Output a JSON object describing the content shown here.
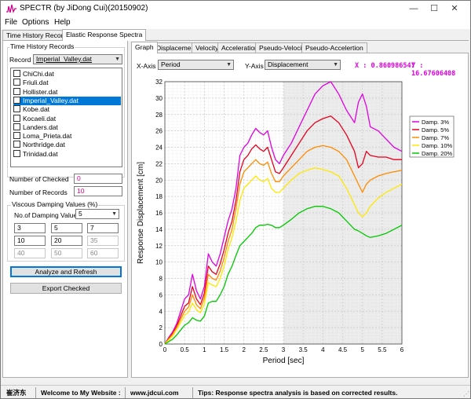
{
  "window": {
    "title": "SPECTR (by JiDong Cui)(20150902)"
  },
  "menu": [
    "File",
    "Options",
    "Help"
  ],
  "main_tabs": [
    "Time History Records",
    "Elastic Response Spectra"
  ],
  "left": {
    "group_title": "Time History Records",
    "record_label": "Record",
    "record_value": "Imperial_Valley.dat",
    "records": [
      "ChiChi.dat",
      "Friuli.dat",
      "Hollister.dat",
      "Imperial_Valley.dat",
      "Kobe.dat",
      "Kocaeli.dat",
      "Landers.dat",
      "Loma_Prieta.dat",
      "Northridge.dat",
      "Trinidad.dat"
    ],
    "selected_index": 3,
    "num_checked_label": "Number of Checked",
    "num_checked_value": "0",
    "num_records_label": "Number of Records",
    "num_records_value": "10",
    "damping_group_title": "Viscous Damping Values (%)",
    "num_damping_label": "No.of Damping Values",
    "num_damping_value": "5",
    "damping_values": [
      "3",
      "5",
      "7",
      "10",
      "20",
      "35",
      "40",
      "50",
      "60"
    ],
    "analyze_button": "Analyze and Refresh",
    "export_button": "Export Checked"
  },
  "right": {
    "tabs": [
      "Graph",
      "Displacement",
      "Velocity",
      "Acceleration",
      "Pseudo-Velocity",
      "Pseudo-Accelertion"
    ],
    "xaxis_label": "X-Axis",
    "xaxis_value": "Period",
    "yaxis_label": "Y-Axis",
    "yaxis_value": "Displacement",
    "x_readout": "X : 0.860986547",
    "y_readout": "Y : 16.67606408"
  },
  "status": {
    "author": "崔济东",
    "welcome": "Welcome to My Website :",
    "website": "www.jdcui.com",
    "tips": "Tips: Response spectra analysis is based on corrected results."
  },
  "chart_data": {
    "type": "line",
    "xlabel": "Period [sec]",
    "ylabel": "Response Displacement [cm]",
    "xlim": [
      0,
      6
    ],
    "ylim": [
      0,
      32
    ],
    "x_ticks": [
      "0",
      "0.5",
      "1",
      "1.5",
      "2",
      "2.5",
      "3",
      "3.5",
      "4",
      "4.5",
      "5",
      "5.5",
      "6"
    ],
    "y_ticks": [
      "0",
      "2",
      "4",
      "6",
      "8",
      "10",
      "12",
      "14",
      "16",
      "18",
      "20",
      "22",
      "24",
      "26",
      "28",
      "30",
      "32"
    ],
    "grid": true,
    "legend_position": "top-right",
    "shaded_regions": [
      [
        3,
        6
      ]
    ],
    "x": [
      0,
      0.1,
      0.2,
      0.3,
      0.4,
      0.5,
      0.6,
      0.7,
      0.8,
      0.9,
      1.0,
      1.1,
      1.2,
      1.3,
      1.4,
      1.5,
      1.6,
      1.7,
      1.8,
      1.9,
      2.0,
      2.1,
      2.2,
      2.3,
      2.4,
      2.5,
      2.6,
      2.7,
      2.8,
      2.9,
      3.0,
      3.2,
      3.4,
      3.6,
      3.8,
      4.0,
      4.2,
      4.4,
      4.6,
      4.8,
      4.9,
      5.0,
      5.1,
      5.2,
      5.4,
      5.6,
      5.8,
      6.0
    ],
    "series": [
      {
        "name": "Damp. 3%",
        "color": "#e000e0",
        "values": [
          0,
          0.8,
          1.5,
          2.5,
          4.0,
          5.5,
          6.0,
          8.5,
          6.5,
          5.5,
          7.0,
          11.0,
          10.0,
          9.5,
          11.0,
          13.0,
          15.0,
          16.5,
          19.0,
          23.0,
          24.0,
          24.5,
          25.5,
          26.3,
          25.8,
          25.5,
          26.0,
          24.0,
          22.5,
          22.0,
          23.0,
          24.5,
          26.5,
          28.5,
          30.5,
          31.5,
          32.0,
          30.5,
          28.5,
          27.0,
          29.5,
          30.5,
          29.0,
          26.5,
          26.0,
          25.0,
          24.0,
          23.5
        ]
      },
      {
        "name": "Damp. 5%",
        "color": "#e8001c",
        "values": [
          0,
          0.7,
          1.3,
          2.2,
          3.4,
          4.6,
          5.0,
          7.0,
          5.5,
          4.8,
          6.2,
          9.5,
          8.8,
          8.5,
          9.8,
          11.5,
          13.5,
          15.0,
          17.5,
          21.0,
          22.5,
          23.0,
          23.8,
          24.3,
          23.8,
          23.5,
          24.0,
          22.5,
          21.0,
          20.8,
          21.5,
          23.0,
          24.5,
          26.0,
          27.0,
          27.5,
          27.8,
          27.0,
          25.5,
          23.5,
          21.5,
          22.0,
          23.5,
          23.0,
          22.8,
          22.8,
          22.5,
          22.5
        ]
      },
      {
        "name": "Damp. 7%",
        "color": "#ff8c00",
        "values": [
          0,
          0.6,
          1.2,
          2.0,
          3.0,
          4.0,
          4.5,
          6.0,
          4.8,
          4.3,
          5.6,
          8.5,
          8.0,
          7.8,
          8.9,
          10.5,
          12.5,
          14.0,
          16.5,
          19.5,
          21.0,
          21.5,
          22.0,
          22.5,
          22.0,
          21.8,
          22.2,
          20.8,
          19.8,
          19.8,
          20.5,
          21.5,
          22.5,
          23.5,
          24.0,
          24.2,
          24.0,
          23.5,
          22.5,
          20.5,
          19.5,
          18.5,
          19.5,
          20.0,
          20.5,
          20.8,
          21.0,
          21.2
        ]
      },
      {
        "name": "Damp. 10%",
        "color": "#ffe800",
        "values": [
          0,
          0.5,
          1.0,
          1.8,
          2.6,
          3.5,
          3.9,
          5.0,
          4.2,
          3.8,
          4.9,
          7.5,
          7.2,
          7.0,
          8.0,
          9.5,
          11.5,
          13.0,
          15.0,
          17.5,
          19.0,
          19.5,
          20.0,
          20.5,
          20.0,
          19.8,
          20.2,
          19.0,
          18.5,
          18.5,
          19.0,
          20.0,
          20.8,
          21.2,
          21.5,
          21.3,
          21.0,
          20.5,
          19.0,
          17.0,
          16.0,
          15.5,
          16.0,
          16.8,
          17.8,
          18.5,
          19.0,
          19.5
        ]
      },
      {
        "name": "Damp. 20%",
        "color": "#00c800",
        "values": [
          0,
          0.3,
          0.6,
          1.1,
          1.7,
          2.3,
          2.6,
          3.2,
          2.9,
          2.8,
          3.4,
          5.0,
          5.2,
          5.2,
          6.0,
          7.0,
          8.5,
          9.5,
          10.8,
          12.0,
          12.5,
          13.0,
          13.5,
          14.2,
          14.5,
          14.5,
          14.6,
          14.5,
          14.2,
          14.2,
          14.5,
          15.2,
          16.0,
          16.5,
          16.8,
          16.8,
          16.5,
          16.0,
          15.0,
          14.0,
          13.8,
          13.5,
          13.2,
          13.0,
          13.2,
          13.5,
          14.0,
          14.5
        ]
      }
    ]
  }
}
